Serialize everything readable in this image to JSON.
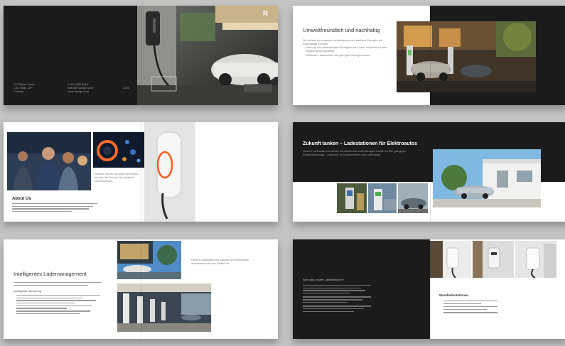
{
  "spreads": {
    "cover": {
      "logo": "R",
      "contact_col1": "123 Street Name\nCity, State, ZIP\nCountry",
      "contact_col2": "+123 4567 8910\nhello@example.com\nwww.design.com",
      "year": "2025"
    },
    "umwelt": {
      "heading": "Umweltfreundlich und nachhaltig",
      "intro": "Wir setzen bei unseren Ladestationen auf saubere Energie und nachhaltige Technik.",
      "bullet1": "Nutzung von erneuerbaren Energien wie Solar und Wind für eine klimaneutrale Mobilität",
      "bullet2": "Effiziente Ladetechnik mit geringem Energieverlust"
    },
    "about": {
      "heading": "About Us",
      "quote": "Schnell, sicher, benutzerfreundlich – wir sind Ihr Partner für moderne Ladelösungen."
    },
    "zukunft": {
      "heading": "Zukunft tanken – Ladestationen für Elektroautos",
      "intro": "Unsere Ladestationen bieten schnelles und zuverlässiges Laden für alle gängigen Elektrofahrzeuge – zuhause, im Unternehmen und unterwegs."
    },
    "lademanagement": {
      "heading": "Intelligentes Lademanagement",
      "subheading": "Intelligente Steuerung",
      "caption": "Unsere Ladestationen passen den Stromfluss automatisch an den Bedarf an."
    },
    "ladestationen": {
      "question": "Was sind unsere Ladestationen?",
      "right_heading": "Wandladestationen"
    }
  }
}
